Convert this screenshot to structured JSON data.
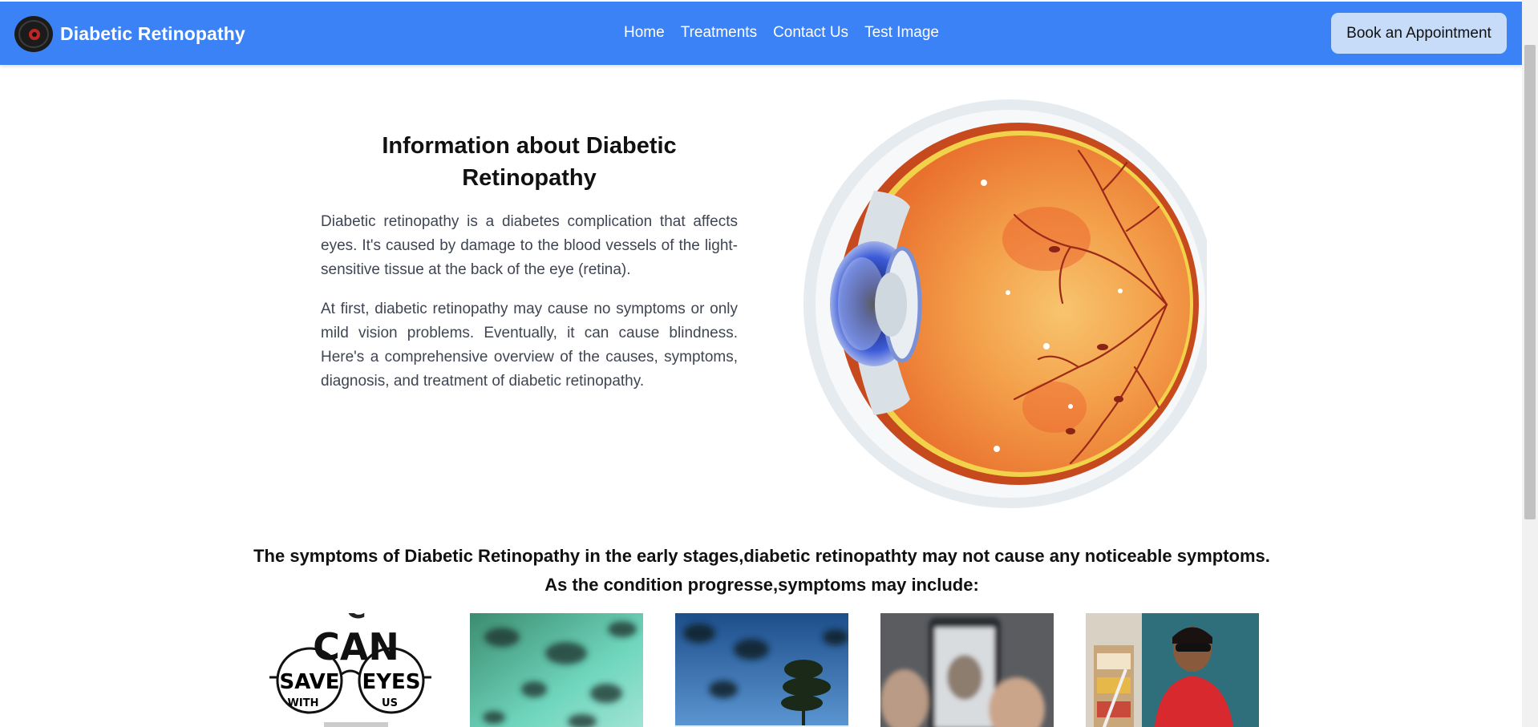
{
  "brand": {
    "name": "Diabetic Retinopathy",
    "logo_icon": "eye-logo-icon"
  },
  "nav": {
    "links": [
      "Home",
      "Treatments",
      "Contact Us",
      "Test Image"
    ],
    "cta": "Book an Appointment"
  },
  "info": {
    "title": "Information about Diabetic Retinopathy",
    "paragraphs": [
      "Diabetic retinopathy is a diabetes complication that affects eyes. It's caused by damage to the blood vessels of the light-sensitive tissue at the back of the eye (retina).",
      "At first, diabetic retinopathy may cause no symptoms or only mild vision problems. Eventually, it can cause blindness. Here's a comprehensive overview of the causes, symptoms, diagnosis, and treatment of diabetic retinopathy."
    ]
  },
  "symptoms": {
    "heading_line1": "The symptoms of Diabetic Retinopathy in the early stages,diabetic retinopathty may not cause any noticeable symptoms.",
    "heading_line2": "As the condition progresse,symptoms may include:",
    "images": [
      {
        "name": "blurred-eye-chart-image",
        "text_lines": [
          "C",
          "CAN",
          "SAVE",
          "EYES",
          "WITH",
          "US"
        ]
      },
      {
        "name": "floaters-green-image"
      },
      {
        "name": "floaters-sky-image"
      },
      {
        "name": "blurred-phone-image"
      },
      {
        "name": "person-sunglasses-image"
      }
    ]
  },
  "colors": {
    "navbar": "#3b82f6",
    "cta_bg": "#c7dcf8",
    "text_dark": "#111111",
    "text_body": "#3f4553"
  }
}
